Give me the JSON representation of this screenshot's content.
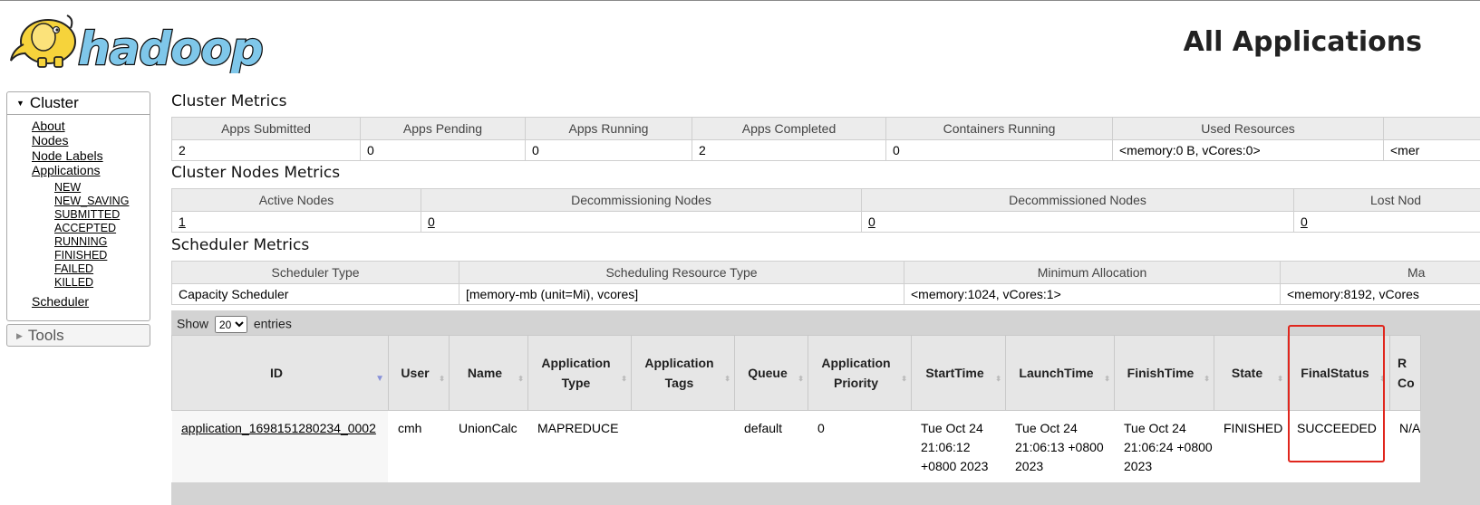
{
  "header": {
    "logo_text": "hadoop",
    "page_title": "All Applications"
  },
  "sidebar": {
    "cluster": {
      "label": "Cluster",
      "links": [
        "About",
        "Nodes",
        "Node Labels",
        "Applications"
      ],
      "app_states": [
        "NEW",
        "NEW_SAVING",
        "SUBMITTED",
        "ACCEPTED",
        "RUNNING",
        "FINISHED",
        "FAILED",
        "KILLED"
      ],
      "scheduler": "Scheduler"
    },
    "tools": {
      "label": "Tools"
    }
  },
  "cluster_metrics": {
    "title": "Cluster Metrics",
    "headers": [
      "Apps Submitted",
      "Apps Pending",
      "Apps Running",
      "Apps Completed",
      "Containers Running",
      "Used Resources",
      ""
    ],
    "values": [
      "2",
      "0",
      "0",
      "2",
      "0",
      "<memory:0 B, vCores:0>",
      "<mer"
    ]
  },
  "cluster_nodes_metrics": {
    "title": "Cluster Nodes Metrics",
    "headers": [
      "Active Nodes",
      "Decommissioning Nodes",
      "Decommissioned Nodes",
      "Lost Nod"
    ],
    "values": [
      "1",
      "0",
      "0",
      "0"
    ]
  },
  "scheduler_metrics": {
    "title": "Scheduler Metrics",
    "headers": [
      "Scheduler Type",
      "Scheduling Resource Type",
      "Minimum Allocation",
      "Ma"
    ],
    "values": [
      "Capacity Scheduler",
      "[memory-mb (unit=Mi), vcores]",
      "<memory:1024, vCores:1>",
      "<memory:8192, vCores"
    ]
  },
  "applications": {
    "show_label": "Show",
    "page_size": "20",
    "entries_label": "entries",
    "columns": [
      "ID",
      "User",
      "Name",
      "Application Type",
      "Application Tags",
      "Queue",
      "Application Priority",
      "StartTime",
      "LaunchTime",
      "FinishTime",
      "State",
      "FinalStatus",
      "R Co"
    ],
    "rows": [
      {
        "id": "application_1698151280234_0002",
        "user": "cmh",
        "name": "UnionCalc",
        "type": "MAPREDUCE",
        "tags": "",
        "queue": "default",
        "priority": "0",
        "start_time": "Tue Oct 24 21:06:12 +0800 2023",
        "launch_time": "Tue Oct 24 21:06:13 +0800 2023",
        "finish_time": "Tue Oct 24 21:06:24 +0800 2023",
        "state": "FINISHED",
        "final_status": "SUCCEEDED",
        "running_containers": "N/A"
      }
    ]
  },
  "colors": {
    "highlight": "#e0261d",
    "logo_blue": "#7fc7ea",
    "logo_yellow": "#f6d33b"
  }
}
